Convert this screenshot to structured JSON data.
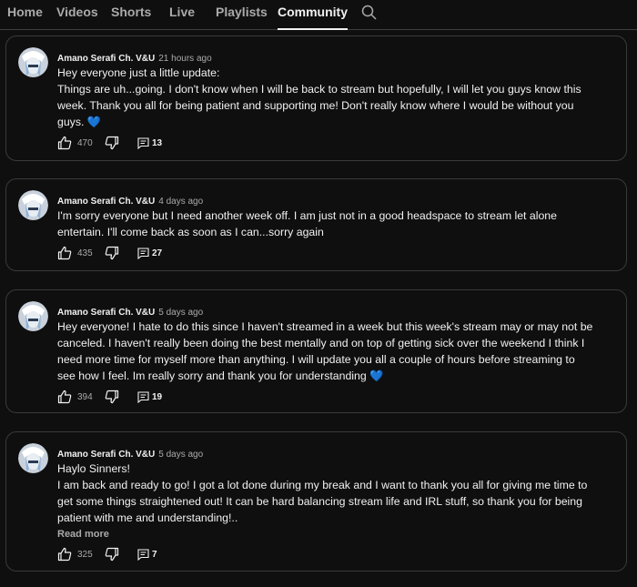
{
  "tabs": {
    "home": "Home",
    "videos": "Videos",
    "shorts": "Shorts",
    "live": "Live",
    "playlists": "Playlists",
    "community": "Community",
    "active": "Community",
    "search_icon": "search-icon"
  },
  "colors": {
    "background": "#0f0f0f",
    "card_border": "#3a3a3a",
    "text_primary": "#f1f1f1",
    "text_secondary": "#aaaaaa",
    "heart": "#3ea6ff"
  },
  "posts": [
    {
      "author": "Amano Serafi Ch. V&U",
      "time": "21 hours ago",
      "lines": [
        "Hey everyone just a little update:",
        "Things are uh...going. I don't know when I will be back to stream but hopefully, I will let you guys know this week. Thank you all for being patient and supporting me! Don't really know where I would be without you guys. 💙"
      ],
      "likes": "470",
      "comments": "13"
    },
    {
      "author": "Amano Serafi Ch. V&U",
      "time": "4 days ago",
      "lines": [
        "I'm sorry everyone but I need another week off. I am just not in a good headspace to stream let alone entertain. I'll come back as soon as I can...sorry again"
      ],
      "likes": "435",
      "comments": "27"
    },
    {
      "author": "Amano Serafi Ch. V&U",
      "time": "5 days ago",
      "lines": [
        "Hey everyone! I hate to do this since I haven't streamed in a week but this week's stream may or may not be canceled. I haven't really been doing the best mentally and on top of getting sick over the weekend I think I need more time for myself more than anything. I will update you all a couple of hours before streaming to see how I feel. Im really sorry and thank you for understanding 💙"
      ],
      "likes": "394",
      "comments": "19"
    },
    {
      "author": "Amano Serafi Ch. V&U",
      "time": "5 days ago",
      "lines": [
        "Haylo Sinners!",
        "I am back and ready to go! I got a lot done during my break and I want to thank you all for giving me time to get some things straightened out! It can be hard balancing stream life and IRL stuff, so thank you for being patient with me and understanding!.."
      ],
      "read_more": "Read more",
      "likes": "325",
      "comments": "7"
    }
  ]
}
